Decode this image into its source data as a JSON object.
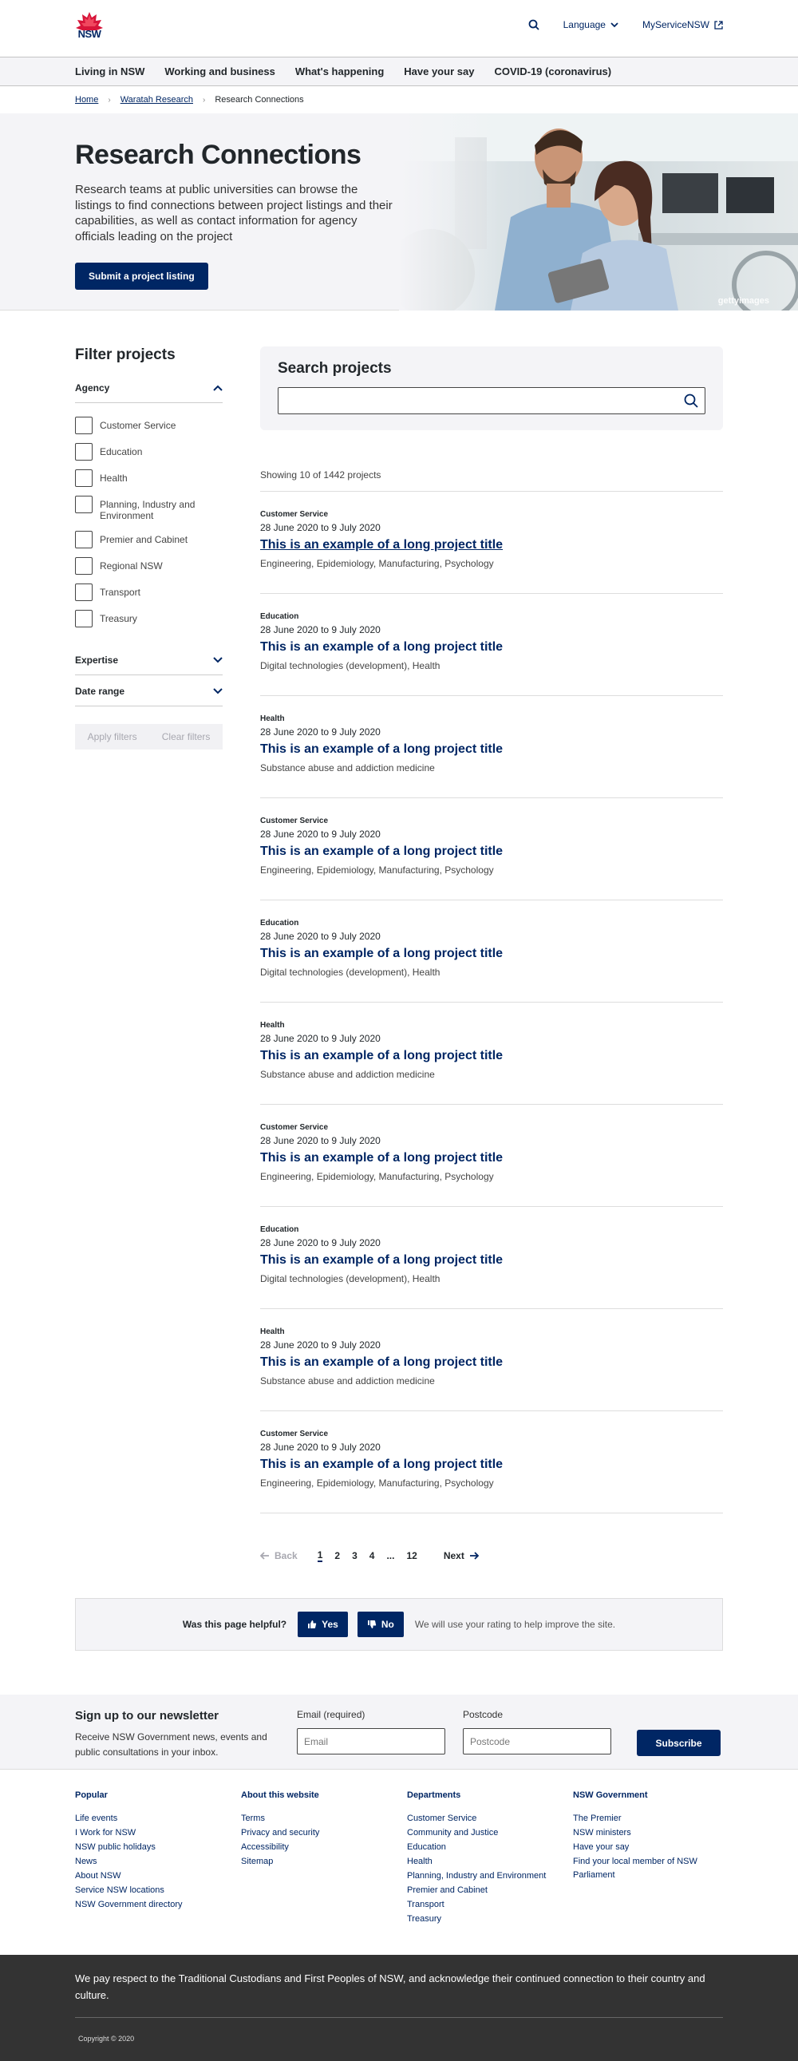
{
  "header": {
    "logo_text": "NSW",
    "language_label": "Language",
    "myservice_label": "MyServiceNSW"
  },
  "nav": {
    "items": [
      "Living in NSW",
      "Working and business",
      "What's happening",
      "Have your say",
      "COVID-19 (coronavirus)"
    ]
  },
  "breadcrumb": {
    "items": [
      "Home",
      "Waratah Research",
      "Research Connections"
    ]
  },
  "hero": {
    "title": "Research Connections",
    "description": "Research teams at public universities can browse the listings to find connections between project listings and their capabilities, as well as contact information for agency officials leading on the project",
    "cta_label": "Submit a project listing",
    "image_credit": "gettyimages"
  },
  "filter": {
    "title": "Filter projects",
    "agency_label": "Agency",
    "agencies": [
      "Customer Service",
      "Education",
      "Health",
      "Planning, Industry and Environment",
      "Premier and Cabinet",
      "Regional NSW",
      "Transport",
      "Treasury"
    ],
    "expertise_label": "Expertise",
    "date_range_label": "Date range",
    "apply_label": "Apply filters",
    "clear_label": "Clear filters"
  },
  "search": {
    "title": "Search projects",
    "placeholder": ""
  },
  "results": {
    "showing": "Showing 10 of 1442 projects",
    "items": [
      {
        "agency": "Customer Service",
        "dates": "28 June 2020 to 9 July 2020",
        "title": "This is an example of a long project title",
        "tags": "Engineering, Epidemiology, Manufacturing, Psychology"
      },
      {
        "agency": "Education",
        "dates": "28 June 2020 to 9 July 2020",
        "title": "This is an example of a long project title",
        "tags": "Digital technologies (development), Health"
      },
      {
        "agency": "Health",
        "dates": "28 June 2020 to 9 July 2020",
        "title": "This is an example of a long project title",
        "tags": "Substance abuse and addiction medicine"
      },
      {
        "agency": "Customer Service",
        "dates": "28 June 2020 to 9 July 2020",
        "title": "This is an example of a long project title",
        "tags": "Engineering, Epidemiology, Manufacturing, Psychology"
      },
      {
        "agency": "Education",
        "dates": "28 June 2020 to 9 July 2020",
        "title": "This is an example of a long project title",
        "tags": "Digital technologies (development), Health"
      },
      {
        "agency": "Health",
        "dates": "28 June 2020 to 9 July 2020",
        "title": "This is an example of a long project title",
        "tags": "Substance abuse and addiction medicine"
      },
      {
        "agency": "Customer Service",
        "dates": "28 June 2020 to 9 July 2020",
        "title": "This is an example of a long project title",
        "tags": "Engineering, Epidemiology, Manufacturing, Psychology"
      },
      {
        "agency": "Education",
        "dates": "28 June 2020 to 9 July 2020",
        "title": "This is an example of a long project title",
        "tags": "Digital technologies (development), Health"
      },
      {
        "agency": "Health",
        "dates": "28 June 2020 to 9 July 2020",
        "title": "This is an example of a long project title",
        "tags": "Substance abuse and addiction medicine"
      },
      {
        "agency": "Customer Service",
        "dates": "28 June 2020 to 9 July 2020",
        "title": "This is an example of a long project title",
        "tags": "Engineering, Epidemiology, Manufacturing, Psychology"
      }
    ]
  },
  "pagination": {
    "back_label": "Back",
    "pages": [
      "1",
      "2",
      "3",
      "4",
      "...",
      "12"
    ],
    "next_label": "Next"
  },
  "feedback": {
    "question": "Was this page helpful?",
    "yes_label": "Yes",
    "no_label": "No",
    "note": "We will use your rating to help improve the site."
  },
  "newsletter": {
    "title": "Sign up to our newsletter",
    "description": "Receive NSW Government news, events and public consultations in your inbox.",
    "email_label": "Email (required)",
    "email_placeholder": "Email",
    "postcode_label": "Postcode",
    "postcode_placeholder": "Postcode",
    "subscribe_label": "Subscribe"
  },
  "footer": {
    "columns": [
      {
        "title": "Popular",
        "links": [
          "Life events",
          "I Work for NSW",
          "NSW public holidays",
          "News",
          "About NSW",
          "Service NSW locations",
          "NSW Government directory"
        ]
      },
      {
        "title": "About this website",
        "links": [
          "Terms",
          "Privacy and security",
          "Accessibility",
          "Sitemap"
        ]
      },
      {
        "title": "Departments",
        "links": [
          "Customer Service",
          "Community and Justice",
          "Education",
          "Health",
          "Planning, Industry and Environment",
          "Premier and Cabinet",
          "Transport",
          "Treasury"
        ]
      },
      {
        "title": "NSW Government",
        "links": [
          "The Premier",
          "NSW ministers",
          "Have your say",
          "Find your local member of NSW Parliament"
        ]
      }
    ],
    "acknowledgement": "We pay respect to the Traditional Custodians and First Peoples of NSW, and acknowledge their continued connection to their country and culture.",
    "copyright": "Copyright © 2020"
  },
  "colors": {
    "brand_navy": "#002664",
    "brand_red": "#d7153a",
    "footer_dark": "#333333"
  }
}
